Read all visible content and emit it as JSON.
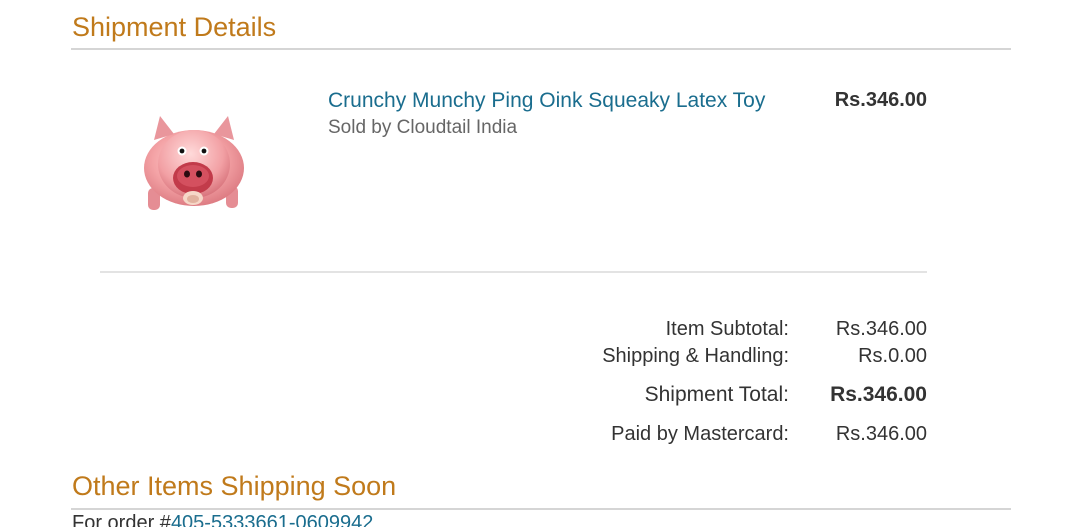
{
  "shipment_details": {
    "title": "Shipment Details"
  },
  "item": {
    "name": "Crunchy Munchy Ping Oink Squeaky Latex Toy",
    "seller": "Sold by Cloudtail India",
    "price": "Rs.346.00",
    "image_icon": "pig-toy-image"
  },
  "summary": {
    "subtotal_label": "Item Subtotal:",
    "subtotal_value": "Rs.346.00",
    "shipping_label": "Shipping & Handling:",
    "shipping_value": "Rs.0.00",
    "total_label": "Shipment Total:",
    "total_value": "Rs.346.00",
    "paid_label": "Paid by Mastercard:",
    "paid_value": "Rs.346.00"
  },
  "other_items": {
    "title": "Other Items Shipping Soon",
    "order_prefix": "For order #",
    "order_number": "405-5333661-0609942"
  },
  "colors": {
    "heading": "#c07a1b",
    "link": "#1a6d8e",
    "text": "#333333",
    "muted": "#666666"
  }
}
